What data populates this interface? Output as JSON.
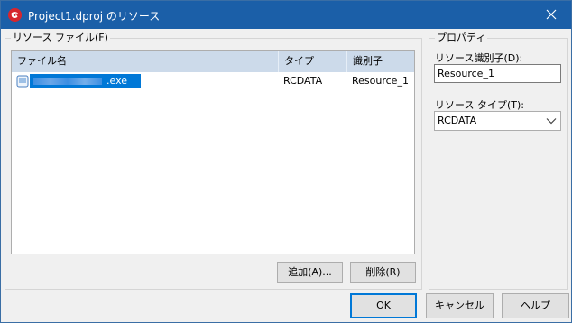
{
  "window": {
    "title": "Project1.dproj のリソース"
  },
  "resource_group": {
    "legend": "リソース ファイル(F)",
    "columns": [
      "ファイル名",
      "タイプ",
      "識別子"
    ],
    "rows": [
      {
        "name_suffix": ".exe",
        "type": "RCDATA",
        "id": "Resource_1"
      }
    ],
    "add_label": "追加(A)...",
    "delete_label": "削除(R)"
  },
  "properties": {
    "legend": "プロパティ",
    "id_label": "リソース識別子(D):",
    "id_value": "Resource_1",
    "type_label": "リソース タイプ(T):",
    "type_value": "RCDATA"
  },
  "footer": {
    "ok_label": "OK",
    "cancel_label": "キャンセル",
    "help_label": "ヘルプ"
  },
  "colors": {
    "title_bar": "#1b5fa8",
    "selection": "#0078d7",
    "header": "#ccdaea"
  },
  "icons": {
    "app": "delphi-logo-icon",
    "close": "close-icon",
    "file": "exe-file-icon",
    "dropdown": "chevron-down-icon"
  }
}
